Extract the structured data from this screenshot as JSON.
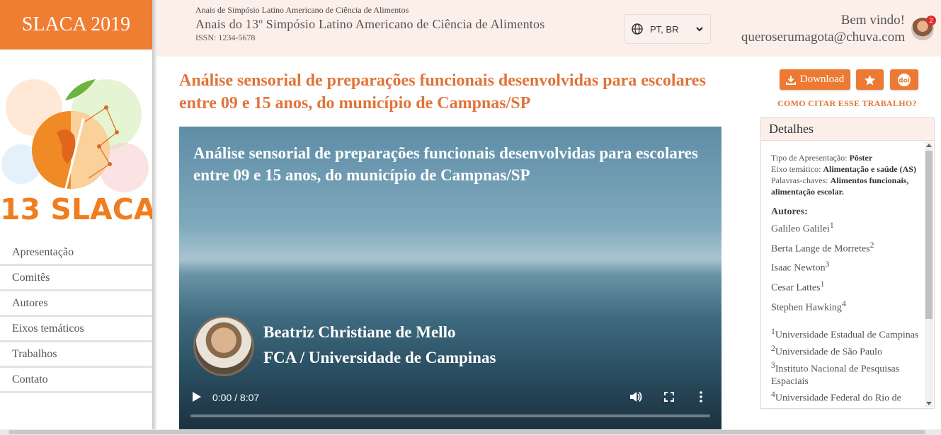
{
  "brand": "SLACA 2019",
  "logo_text": "13 SLACA",
  "nav": [
    "Apresentação",
    "Comitês",
    "Autores",
    "Eixos temáticos",
    "Trabalhos",
    "Contato"
  ],
  "header": {
    "proceedings_small": "Anais de Simpósio Latino Americano de Ciência de Alimentos",
    "proceedings_title": "Anais do 13º Simpósio Latino Americano de Ciência de Alimentos",
    "issn": "ISSN: 1234-5678",
    "language": "PT, BR",
    "welcome": "Bem vindo!",
    "email": "queroserumagota@chuva.com",
    "notification_count": "2"
  },
  "paper": {
    "title": "Análise sensorial de preparações funcionais desenvolvidas para escolares entre 09 e 15 anos, do município de Campnas/SP"
  },
  "video": {
    "title": "Análise sensorial de preparações funcionais desenvolvidas para escolares entre 09 e 15 anos, do município de Campnas/SP",
    "presenter_name": "Beatriz Christiane de Mello",
    "presenter_institution": "FCA / Universidade de Campinas",
    "time": "0:00 / 8:07",
    "progress": 0
  },
  "actions": {
    "download_label": "Download",
    "cite_label": "COMO CITAR ESSE TRABALHO?"
  },
  "details": {
    "heading": "Detalhes",
    "presentation_type_label": "Tipo de Apresentação:",
    "presentation_type": "Pôster",
    "axis_label": "Eixo temático:",
    "axis": "Alimentação e saúde (AS)",
    "keywords_label": "Palavras-chaves:",
    "keywords": "Alimentos funcionais, alimentação escolar.",
    "authors_heading": "Autores:",
    "authors": [
      {
        "name": "Galileo Galilei",
        "sup": "1"
      },
      {
        "name": "Berta Lange de Morretes",
        "sup": "2"
      },
      {
        "name": "Isaac Newton",
        "sup": "3"
      },
      {
        "name": "Cesar Lattes",
        "sup": "1"
      },
      {
        "name": "Stephen Hawking",
        "sup": "4"
      }
    ],
    "affiliations": [
      {
        "sup": "1",
        "name": "Universidade Estadual de Campinas"
      },
      {
        "sup": "2",
        "name": "Universidade de São Paulo"
      },
      {
        "sup": "3",
        "name": "Instituto Nacional de Pesquisas Espaciais"
      },
      {
        "sup": "4",
        "name": "Universidade Federal do Rio de Janeiro"
      }
    ]
  },
  "colors": {
    "accent": "#ef7d32",
    "header_bg": "#fcefea",
    "title": "#e0743a"
  }
}
